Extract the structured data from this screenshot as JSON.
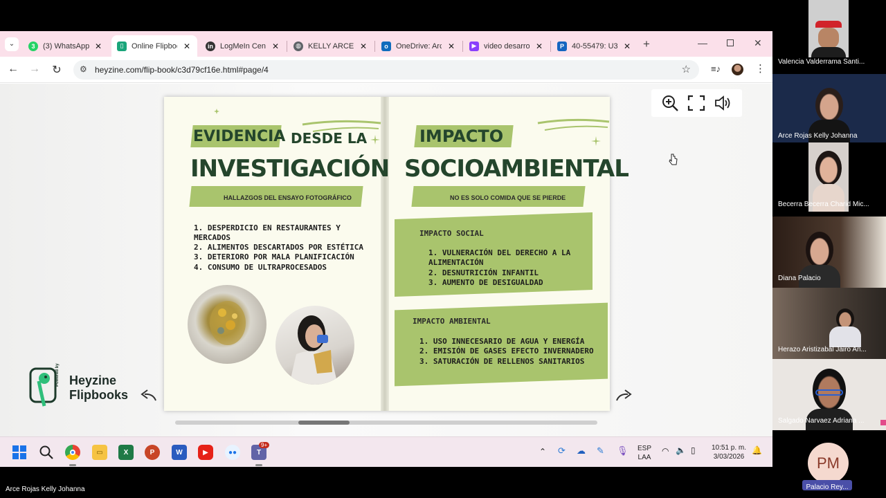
{
  "browser": {
    "tabs": [
      {
        "label": "(3) WhatsApp",
        "icon": "whatsapp-icon",
        "color": "#25d366",
        "badge": "3"
      },
      {
        "label": "Online Flipbook",
        "icon": "heyzine-icon",
        "color": "#1aa57a",
        "badge": ""
      },
      {
        "label": "LogMeIn Central",
        "icon": "logmein-icon",
        "color": "#333333",
        "badge": ""
      },
      {
        "label": "KELLY ARCE - ",
        "icon": "chrome-tab-icon",
        "color": "#5f6368",
        "badge": ""
      },
      {
        "label": "OneDrive: Arc",
        "icon": "outlook-icon",
        "color": "#0f6cbd",
        "badge": ""
      },
      {
        "label": "video desarrollo",
        "icon": "video-icon",
        "color": "#8a3ffc",
        "badge": ""
      },
      {
        "label": "40-55479: U3",
        "icon": "doc-icon",
        "color": "#1565c0",
        "badge": ""
      }
    ],
    "url": "heyzine.com/flip-book/c3d79cf16e.html#page/4"
  },
  "flipbook": {
    "left_page": {
      "title_small": "EVIDENCIA",
      "title_small_2": "DESDE LA",
      "title_big": "INVESTIGACIÓN",
      "subtitle": "HALLAZGOS DEL ENSAYO FOTOGRÁFICO",
      "items": [
        "1. DESPERDICIO EN RESTAURANTES Y",
        "    MERCADOS",
        "2. ALIMENTOS DESCARTADOS POR ESTÉTICA",
        "3. DETERIORO POR MALA PLANIFICACIÓN",
        "4. CONSUMO DE ULTRAPROCESADOS"
      ]
    },
    "right_page": {
      "title_small": "IMPACTO",
      "title_big": "SOCIOAMBIENTAL",
      "subtitle": "NO ES SOLO COMIDA QUE SE PIERDE",
      "social_heading": "IMPACTO SOCIAL",
      "social_items": [
        "1. VULNERACIÓN DEL DERECHO A LA",
        "    ALIMENTACIÓN",
        "2. DESNUTRICIÓN INFANTIL",
        "3. AUMENTO DE DESIGUALDAD"
      ],
      "env_heading": "IMPACTO AMBIENTAL",
      "env_items": [
        "1. USO INNECESARIO DE AGUA Y ENERGÍA",
        "2. EMISIÓN DE GASES EFECTO INVERNADERO",
        "3. SATURACIÓN DE RELLENOS SANITARIOS"
      ]
    },
    "logo": {
      "powered": "Powered by",
      "line1": "Heyzine",
      "line2": "Flipbooks"
    }
  },
  "taskbar": {
    "lang1": "ESP",
    "lang2": "LAA",
    "time": "10:51 p. m.",
    "date": "3/03/2026",
    "teams_badge": "9+"
  },
  "participants": [
    {
      "name": "Valencia Valderrama Santi...",
      "bg": "#c9c9c9"
    },
    {
      "name": "Arce Rojas Kelly Johanna",
      "bg": "#1b2a4a"
    },
    {
      "name": "Becerra Becerra Charid Mic...",
      "bg": "#d6d0cc"
    },
    {
      "name": "Diana Palacio",
      "bg": "#3a2a22"
    },
    {
      "name": "Herazo Aristizabal Jairo An...",
      "bg": "#5b5048"
    },
    {
      "name": "Salgado Narvaez Adriana ...",
      "bg": "#e8e4e0"
    }
  ],
  "self_tile": {
    "initials": "PM",
    "name": "Palacio Rey..."
  },
  "presenter_label": "Arce Rojas Kelly Johanna"
}
